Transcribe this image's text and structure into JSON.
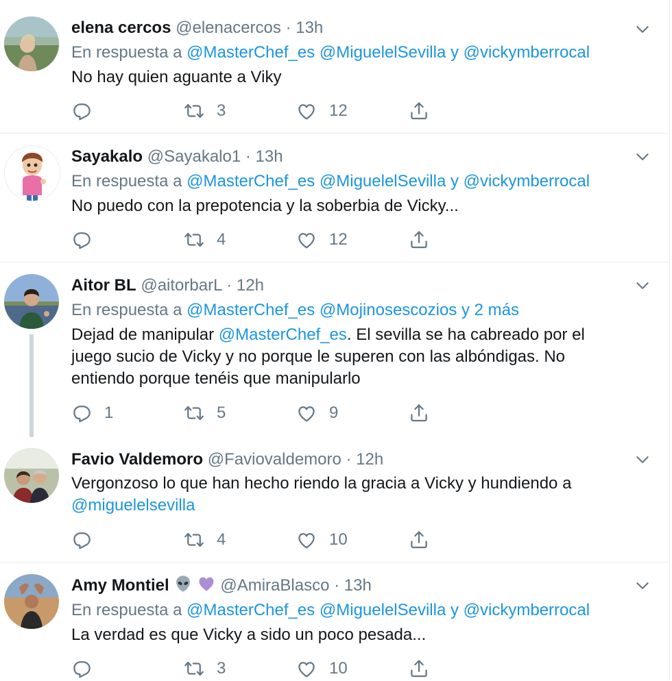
{
  "tweets": [
    {
      "name": "elena cercos",
      "handle": "@elenacercos",
      "dot": "·",
      "time": "13h",
      "reply_prefix": "En respuesta a",
      "reply_targets": "@MasterChef_es @MiguelelSevilla y @vickymberrocal",
      "text": "No hay quien aguante a Viky",
      "replies": "",
      "retweets": "3",
      "likes": "12"
    },
    {
      "name": "Sayakalo",
      "handle": "@Sayakalo1",
      "dot": "·",
      "time": "13h",
      "reply_prefix": "En respuesta a",
      "reply_targets": "@MasterChef_es @MiguelelSevilla y @vickymberrocal",
      "text": "No puedo con la prepotencia y la soberbia de Vicky...",
      "replies": "",
      "retweets": "4",
      "likes": "12"
    },
    {
      "name": "Aitor BL",
      "handle": "@aitorbarL",
      "dot": "·",
      "time": "12h",
      "reply_prefix": "En respuesta a",
      "reply_targets": "@MasterChef_es @Mojinosescozios y 2 más",
      "text_before": "Dejad de manipular ",
      "text_mention": "@MasterChef_es",
      "text_after": ". El sevilla se ha cabreado por el juego sucio de Vicky y no porque le superen con las albóndigas. No entiendo porque tenéis que manipularlo",
      "replies": "1",
      "retweets": "5",
      "likes": "9"
    },
    {
      "name": "Favio Valdemoro",
      "handle": "@Faviovaldemoro",
      "dot": "·",
      "time": "12h",
      "text_before": "Vergonzoso lo que han hecho riendo la gracia a Vicky y hundiendo a ",
      "text_mention": "@miguelelsevilla",
      "replies": "",
      "retweets": "4",
      "likes": "10"
    },
    {
      "name": "Amy Montiel",
      "name_emoji": "alien-and-purple-heart",
      "handle": "@AmiraBlasco",
      "dot": "·",
      "time": "13h",
      "reply_prefix": "En respuesta a",
      "reply_targets": "@MasterChef_es @MiguelelSevilla y @vickymberrocal",
      "text": "La verdad es que Vicky a sido un poco pesada...",
      "replies": "",
      "retweets": "3",
      "likes": "10"
    }
  ],
  "icons": {
    "reply": "reply-icon",
    "retweet": "retweet-icon",
    "like": "heart-icon",
    "share": "share-icon",
    "menu": "chevron-down-icon"
  },
  "colors": {
    "link": "#1b95e0",
    "muted": "#657786",
    "text": "#14171a",
    "divider": "#e6ecf0"
  }
}
